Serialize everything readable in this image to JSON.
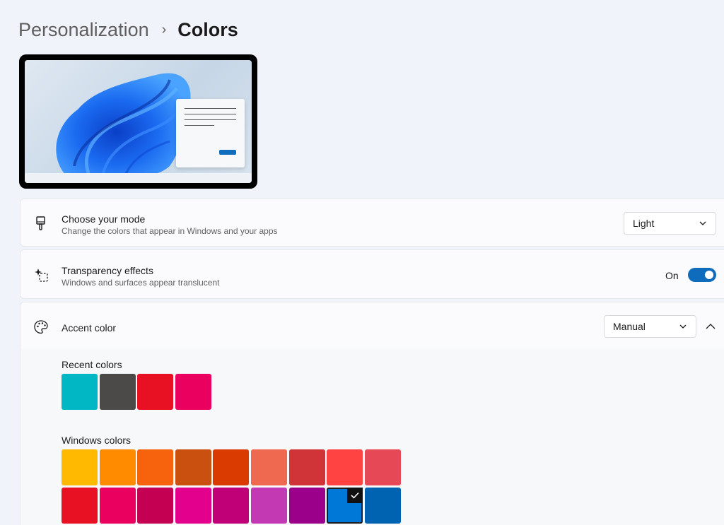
{
  "breadcrumb": {
    "parent": "Personalization",
    "separator": "›",
    "current": "Colors"
  },
  "preview": {
    "window_button_color": "#0f6cbd"
  },
  "mode": {
    "title": "Choose your mode",
    "subtitle": "Change the colors that appear in Windows and your apps",
    "value": "Light",
    "icon": "brush-icon"
  },
  "transparency": {
    "title": "Transparency effects",
    "subtitle": "Windows and surfaces appear translucent",
    "state_label": "On",
    "enabled": true,
    "icon": "transparency-sparkle-icon"
  },
  "accent": {
    "title": "Accent color",
    "value": "Manual",
    "icon": "palette-icon",
    "expanded": true
  },
  "recent_colors": {
    "label": "Recent colors",
    "colors": [
      "#00b7c3",
      "#4c4a48",
      "#e81123",
      "#ea005e"
    ]
  },
  "windows_colors": {
    "label": "Windows colors",
    "rows": [
      [
        "#ffb900",
        "#ff8c00",
        "#f7630c",
        "#ca5010",
        "#da3b01",
        "#ef6950",
        "#d13438",
        "#ff4343",
        "#e74856"
      ],
      [
        "#e81123",
        "#ea005e",
        "#c30052",
        "#e3008c",
        "#bf0077",
        "#c239b3",
        "#9a0089",
        "#0078d7",
        "#0063b1"
      ]
    ],
    "selected_color": "#0078d7"
  },
  "colors": {
    "accent": "#0f6cbd",
    "page_bg": "#f0f3f9"
  }
}
